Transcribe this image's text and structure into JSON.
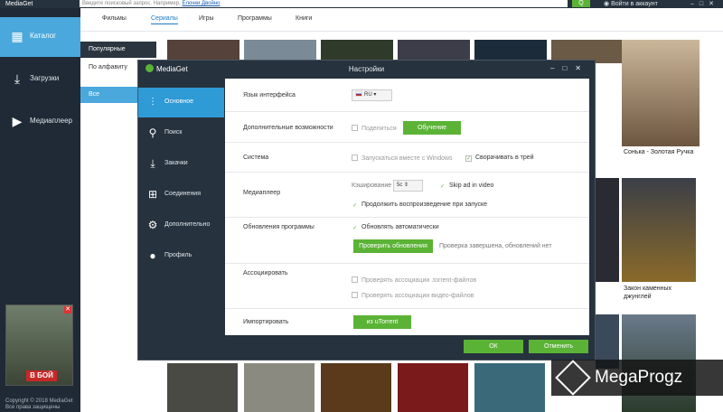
{
  "app": {
    "title": "MediaGet"
  },
  "topbar": {
    "search_placeholder": "Введите поисковый запрос. Например,",
    "search_hint_link": "Ёлочки Двойно",
    "search_button": "Q",
    "login": "Войти в аккаунт"
  },
  "sidebar": {
    "items": [
      {
        "label": "Каталог",
        "icon": "grid-icon"
      },
      {
        "label": "Загрузки",
        "icon": "download-icon"
      },
      {
        "label": "Медиаплеер",
        "icon": "play-icon"
      }
    ],
    "ad_button": "В БОЙ",
    "copyright": "Copyright © 2018 MediaGet",
    "rights": "Все права защищены"
  },
  "catalog": {
    "tabs": [
      "Фильмы",
      "Сериалы",
      "Игры",
      "Программы",
      "Книги"
    ],
    "selected_tab": "Сериалы",
    "filters": [
      "Популярные",
      "По алфавиту",
      "Все"
    ],
    "poster_labels": {
      "p1": "Сонька - Золотая Ручка",
      "p2": "Закон каменных джунглей"
    }
  },
  "dialog": {
    "brand": "MediaGet",
    "title": "Настройки",
    "nav": [
      {
        "label": "Основное",
        "icon": "sliders-icon"
      },
      {
        "label": "Поиск",
        "icon": "search-icon"
      },
      {
        "label": "Закачки",
        "icon": "download-icon"
      },
      {
        "label": "Соединения",
        "icon": "network-icon"
      },
      {
        "label": "Дополнительно",
        "icon": "gear-icon"
      },
      {
        "label": "Профиль",
        "icon": "user-icon"
      }
    ],
    "rows": {
      "language": {
        "label": "Язык интерфейса",
        "value": "RU"
      },
      "extras": {
        "label": "Дополнительные возможности",
        "share": "Поделиться",
        "tutorial": "Обучение"
      },
      "system": {
        "label": "Система",
        "autostart": "Запускаться вместе с Windows",
        "tray": "Сворачивать в трей"
      },
      "media": {
        "label": "Медиаплеер",
        "cache_label": "Кэширование",
        "cache_value": "5с",
        "skip_ad": "Skip ad in video",
        "resume": "Продолжить воспроизведение при запуске"
      },
      "updates": {
        "label": "Обновления программы",
        "auto": "Обновлять автоматически",
        "check": "Проверить обновления",
        "status": "Проверка завершена, обновлений нет"
      },
      "assoc": {
        "label": "Ассоциировать",
        "torrent": "Проверять ассоциации .torrent-файлов",
        "video": "Проверять ассоциации видео-файлов"
      },
      "import": {
        "label": "Импортировать",
        "button": "из uTorrent"
      }
    },
    "ok": "ОК",
    "cancel": "Отменить"
  },
  "watermark": "MegaProgz",
  "colors": {
    "accent": "#5bb336",
    "active": "#4aa8dd",
    "dark": "#26323e"
  }
}
